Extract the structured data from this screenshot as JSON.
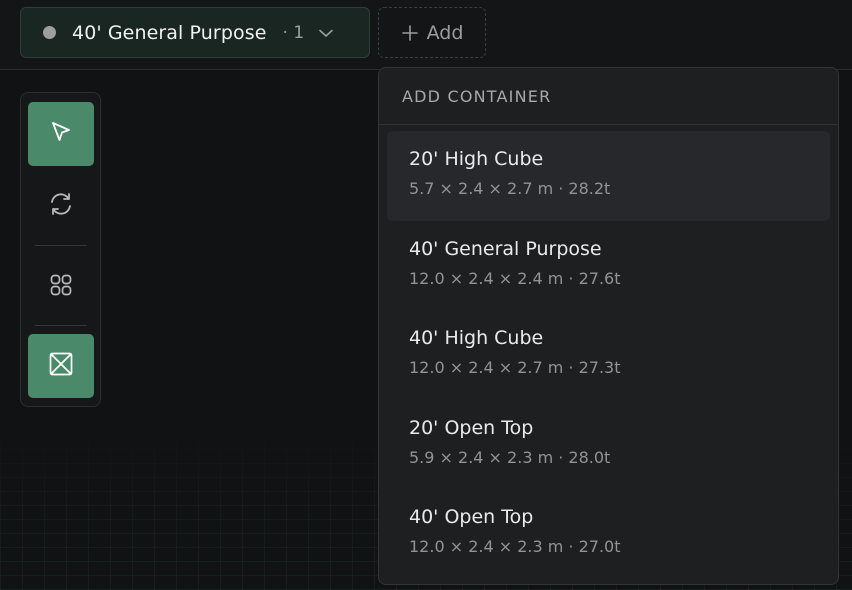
{
  "topbar": {
    "active_container": {
      "name": "40' General Purpose",
      "count": "· 1",
      "dot_color": "#9e9e9e"
    },
    "add_label": "Add"
  },
  "toolbar": {
    "tools": [
      {
        "name": "select-tool",
        "icon": "cursor-arrow-icon",
        "active": true
      },
      {
        "name": "rotate-tool",
        "icon": "rotate-icon",
        "active": false
      },
      {
        "name": "grid-tool",
        "icon": "grid-four-icon",
        "active": false
      },
      {
        "name": "container-view-tool",
        "icon": "box-x-icon",
        "active": true
      }
    ],
    "active_color": "#4a8a6a"
  },
  "dropdown": {
    "title": "ADD CONTAINER",
    "items": [
      {
        "name": "20' High Cube",
        "dims": "5.7 × 2.4 × 2.7 m · 28.2t"
      },
      {
        "name": "40' General Purpose",
        "dims": "12.0 × 2.4 × 2.4 m · 27.6t"
      },
      {
        "name": "40' High Cube",
        "dims": "12.0 × 2.4 × 2.7 m · 27.3t"
      },
      {
        "name": "20' Open Top",
        "dims": "5.9 × 2.4 × 2.3 m · 28.0t"
      },
      {
        "name": "40' Open Top",
        "dims": "12.0 × 2.4 × 2.3 m · 27.0t"
      }
    ]
  }
}
